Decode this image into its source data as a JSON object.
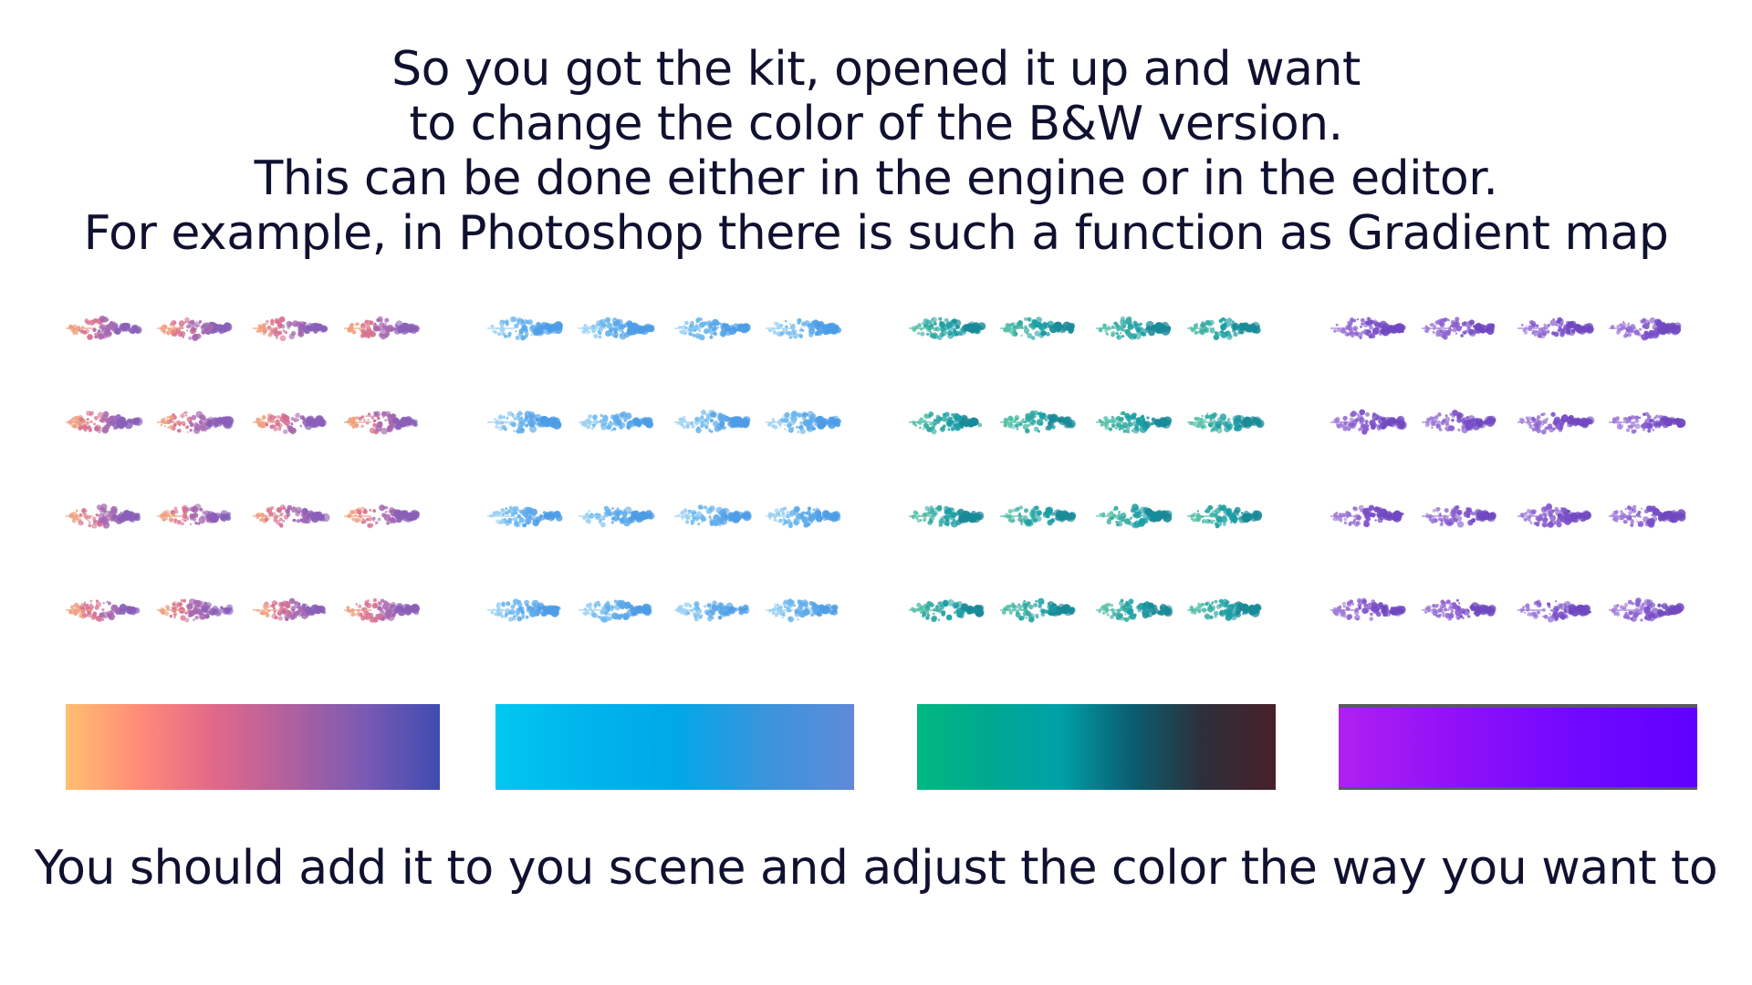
{
  "intro": {
    "lines": [
      "So you got the kit, opened it up and want",
      "to change the color of the B&W version.",
      "This can be done either in the engine or in the editor.",
      "For example, in Photoshop there is such a function as Gradient map"
    ]
  },
  "outro": {
    "text": "You should add it to you scene and adjust the color the way you want to"
  },
  "palettes": [
    {
      "name": "sunset",
      "stops": [
        "#ffbf70",
        "#ff8a78",
        "#e0688a",
        "#b0609e",
        "#7a5ab4",
        "#3f4bb0"
      ],
      "brush_colors": [
        "#f0a080",
        "#d77090",
        "#a768b0",
        "#8a5fb8"
      ]
    },
    {
      "name": "sky-blue",
      "stops": [
        "#00c8f0",
        "#00b4ec",
        "#00a8e8",
        "#3a94dc",
        "#5f8ad8"
      ],
      "brush_colors": [
        "#9cd2f4",
        "#6bb7ee",
        "#5aa8ea",
        "#4c9ce6"
      ]
    },
    {
      "name": "teal-dark",
      "stops": [
        "#00b880",
        "#00a890",
        "#00a0a8",
        "#0a5d70",
        "#2e2e3a",
        "#48202a"
      ],
      "brush_colors": [
        "#56c0a8",
        "#2ea8a0",
        "#1a9ea4",
        "#198a98"
      ]
    },
    {
      "name": "violet",
      "stops": [
        "#b020f0",
        "#9010f8",
        "#7008ff",
        "#6000ff"
      ],
      "border": "#5a5a5a",
      "brush_colors": [
        "#a07cd8",
        "#8c60d0",
        "#7a4ec8",
        "#7048c0"
      ]
    }
  ]
}
